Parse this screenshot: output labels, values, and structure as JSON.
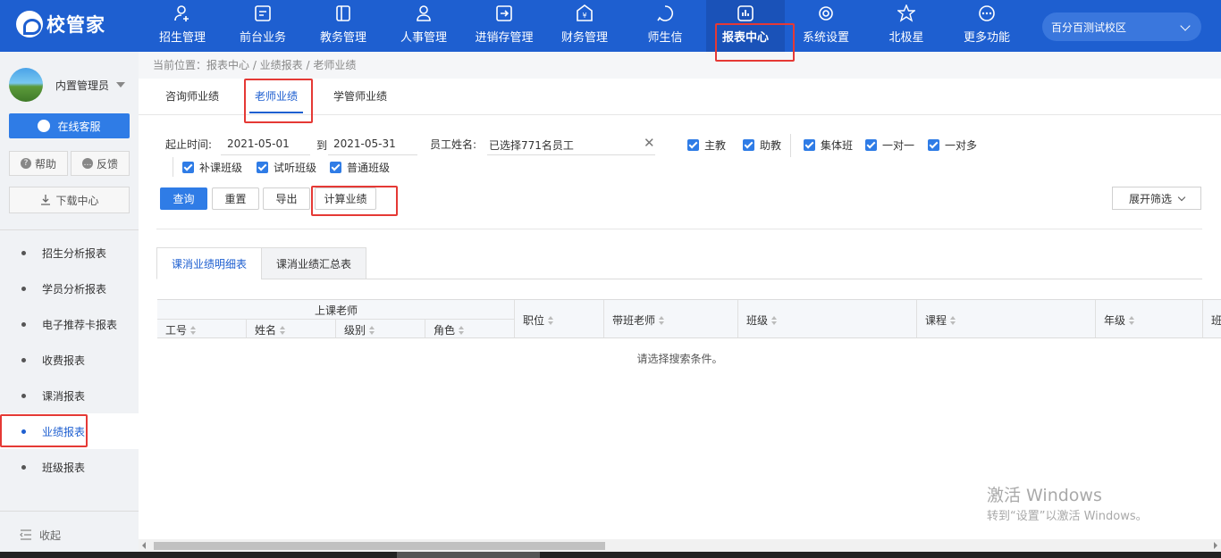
{
  "brand": {
    "name": "校管家"
  },
  "nav": [
    {
      "label": "招生管理",
      "icon": "person-add-icon"
    },
    {
      "label": "前台业务",
      "icon": "monitor-icon"
    },
    {
      "label": "教务管理",
      "icon": "book-icon"
    },
    {
      "label": "人事管理",
      "icon": "person-icon"
    },
    {
      "label": "进销存管理",
      "icon": "box-arrow-icon"
    },
    {
      "label": "财务管理",
      "icon": "yen-shield-icon"
    },
    {
      "label": "师生信",
      "icon": "chat-icon"
    },
    {
      "label": "报表中心",
      "icon": "bar-chart-icon"
    },
    {
      "label": "系统设置",
      "icon": "gear-icon"
    },
    {
      "label": "北极星",
      "icon": "star-icon"
    },
    {
      "label": "更多功能",
      "icon": "more-icon"
    }
  ],
  "campus": {
    "label": "百分百测试校区"
  },
  "sidebar": {
    "user": "内置管理员",
    "service": "在线客服",
    "help": "帮助",
    "feedback": "反馈",
    "download": "下载中心",
    "items": [
      "招生分析报表",
      "学员分析报表",
      "电子推荐卡报表",
      "收费报表",
      "课消报表",
      "业绩报表",
      "班级报表"
    ],
    "collapse": "收起"
  },
  "breadcrumb": "当前位置：报表中心 / 业绩报表 / 老师业绩",
  "subtabs": [
    "咨询师业绩",
    "老师业绩",
    "学管师业绩"
  ],
  "filters": {
    "date_label": "起止时间:",
    "date_from": "2021-05-01",
    "to_label": "到",
    "date_to": "2021-05-31",
    "staff_label": "员工姓名:",
    "staff_value": "已选择771名员工",
    "checks_row1": [
      "主教",
      "助教",
      "集体班",
      "一对一",
      "一对多"
    ],
    "checks_row2": [
      "补课班级",
      "试听班级",
      "普通班级"
    ]
  },
  "buttons": {
    "query": "查询",
    "reset": "重置",
    "export": "导出",
    "calc": "计算业绩",
    "expand": "展开筛选"
  },
  "content_tabs": [
    "课消业绩明细表",
    "课消业绩汇总表"
  ],
  "table": {
    "group_header": "上课老师",
    "sub_columns": [
      "工号",
      "姓名",
      "级别",
      "角色"
    ],
    "columns": [
      "职位",
      "带班老师",
      "班级",
      "课程",
      "年级",
      "班"
    ],
    "empty_text": "请选择搜索条件。"
  },
  "watermark": {
    "title": "激活 Windows",
    "subtitle": "转到“设置”以激活 Windows。"
  },
  "colors": {
    "primary": "#1e5fd0",
    "accent": "#2f7ce6",
    "highlight": "#e53935"
  }
}
